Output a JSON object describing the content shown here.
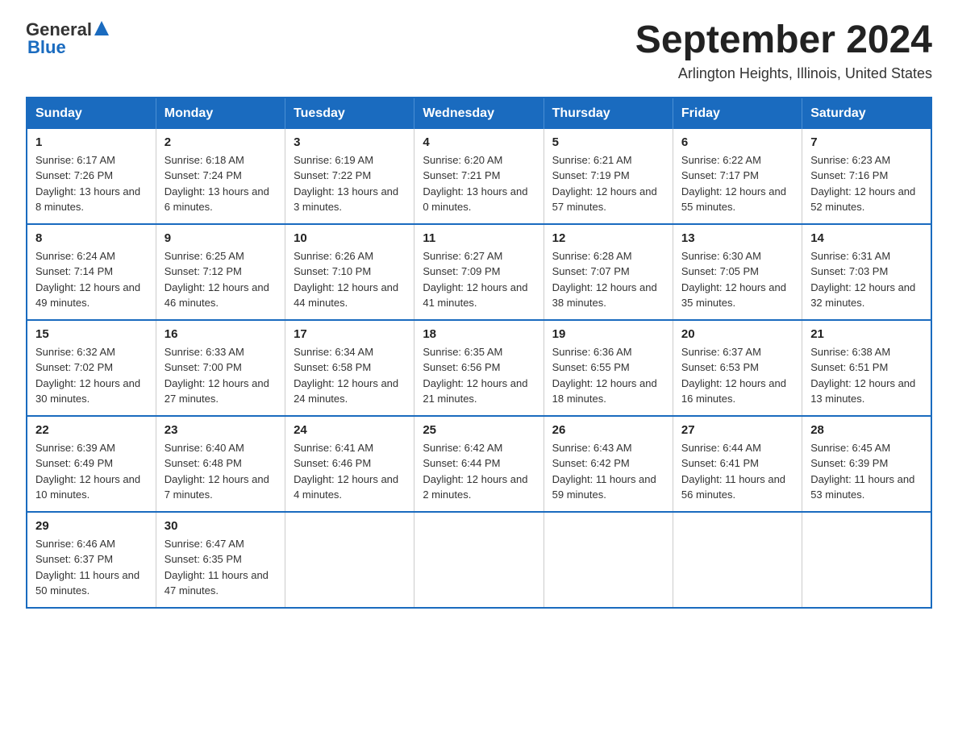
{
  "logo": {
    "text_general": "General",
    "text_blue": "Blue"
  },
  "header": {
    "title": "September 2024",
    "subtitle": "Arlington Heights, Illinois, United States"
  },
  "weekdays": [
    "Sunday",
    "Monday",
    "Tuesday",
    "Wednesday",
    "Thursday",
    "Friday",
    "Saturday"
  ],
  "weeks": [
    [
      {
        "day": "1",
        "sunrise": "6:17 AM",
        "sunset": "7:26 PM",
        "daylight": "13 hours and 8 minutes."
      },
      {
        "day": "2",
        "sunrise": "6:18 AM",
        "sunset": "7:24 PM",
        "daylight": "13 hours and 6 minutes."
      },
      {
        "day": "3",
        "sunrise": "6:19 AM",
        "sunset": "7:22 PM",
        "daylight": "13 hours and 3 minutes."
      },
      {
        "day": "4",
        "sunrise": "6:20 AM",
        "sunset": "7:21 PM",
        "daylight": "13 hours and 0 minutes."
      },
      {
        "day": "5",
        "sunrise": "6:21 AM",
        "sunset": "7:19 PM",
        "daylight": "12 hours and 57 minutes."
      },
      {
        "day": "6",
        "sunrise": "6:22 AM",
        "sunset": "7:17 PM",
        "daylight": "12 hours and 55 minutes."
      },
      {
        "day": "7",
        "sunrise": "6:23 AM",
        "sunset": "7:16 PM",
        "daylight": "12 hours and 52 minutes."
      }
    ],
    [
      {
        "day": "8",
        "sunrise": "6:24 AM",
        "sunset": "7:14 PM",
        "daylight": "12 hours and 49 minutes."
      },
      {
        "day": "9",
        "sunrise": "6:25 AM",
        "sunset": "7:12 PM",
        "daylight": "12 hours and 46 minutes."
      },
      {
        "day": "10",
        "sunrise": "6:26 AM",
        "sunset": "7:10 PM",
        "daylight": "12 hours and 44 minutes."
      },
      {
        "day": "11",
        "sunrise": "6:27 AM",
        "sunset": "7:09 PM",
        "daylight": "12 hours and 41 minutes."
      },
      {
        "day": "12",
        "sunrise": "6:28 AM",
        "sunset": "7:07 PM",
        "daylight": "12 hours and 38 minutes."
      },
      {
        "day": "13",
        "sunrise": "6:30 AM",
        "sunset": "7:05 PM",
        "daylight": "12 hours and 35 minutes."
      },
      {
        "day": "14",
        "sunrise": "6:31 AM",
        "sunset": "7:03 PM",
        "daylight": "12 hours and 32 minutes."
      }
    ],
    [
      {
        "day": "15",
        "sunrise": "6:32 AM",
        "sunset": "7:02 PM",
        "daylight": "12 hours and 30 minutes."
      },
      {
        "day": "16",
        "sunrise": "6:33 AM",
        "sunset": "7:00 PM",
        "daylight": "12 hours and 27 minutes."
      },
      {
        "day": "17",
        "sunrise": "6:34 AM",
        "sunset": "6:58 PM",
        "daylight": "12 hours and 24 minutes."
      },
      {
        "day": "18",
        "sunrise": "6:35 AM",
        "sunset": "6:56 PM",
        "daylight": "12 hours and 21 minutes."
      },
      {
        "day": "19",
        "sunrise": "6:36 AM",
        "sunset": "6:55 PM",
        "daylight": "12 hours and 18 minutes."
      },
      {
        "day": "20",
        "sunrise": "6:37 AM",
        "sunset": "6:53 PM",
        "daylight": "12 hours and 16 minutes."
      },
      {
        "day": "21",
        "sunrise": "6:38 AM",
        "sunset": "6:51 PM",
        "daylight": "12 hours and 13 minutes."
      }
    ],
    [
      {
        "day": "22",
        "sunrise": "6:39 AM",
        "sunset": "6:49 PM",
        "daylight": "12 hours and 10 minutes."
      },
      {
        "day": "23",
        "sunrise": "6:40 AM",
        "sunset": "6:48 PM",
        "daylight": "12 hours and 7 minutes."
      },
      {
        "day": "24",
        "sunrise": "6:41 AM",
        "sunset": "6:46 PM",
        "daylight": "12 hours and 4 minutes."
      },
      {
        "day": "25",
        "sunrise": "6:42 AM",
        "sunset": "6:44 PM",
        "daylight": "12 hours and 2 minutes."
      },
      {
        "day": "26",
        "sunrise": "6:43 AM",
        "sunset": "6:42 PM",
        "daylight": "11 hours and 59 minutes."
      },
      {
        "day": "27",
        "sunrise": "6:44 AM",
        "sunset": "6:41 PM",
        "daylight": "11 hours and 56 minutes."
      },
      {
        "day": "28",
        "sunrise": "6:45 AM",
        "sunset": "6:39 PM",
        "daylight": "11 hours and 53 minutes."
      }
    ],
    [
      {
        "day": "29",
        "sunrise": "6:46 AM",
        "sunset": "6:37 PM",
        "daylight": "11 hours and 50 minutes."
      },
      {
        "day": "30",
        "sunrise": "6:47 AM",
        "sunset": "6:35 PM",
        "daylight": "11 hours and 47 minutes."
      },
      null,
      null,
      null,
      null,
      null
    ]
  ]
}
